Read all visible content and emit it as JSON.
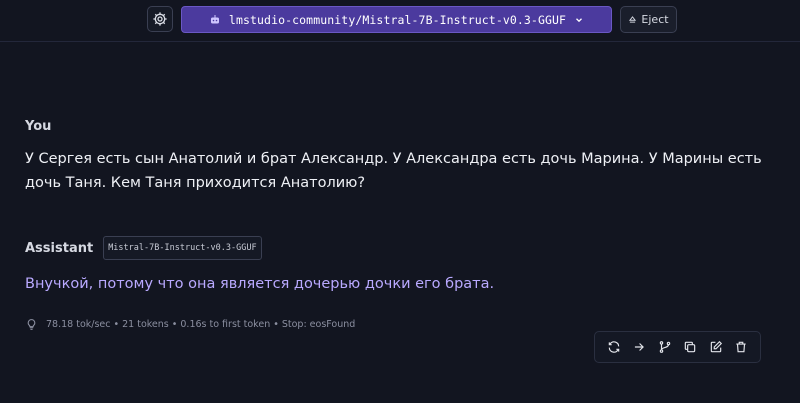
{
  "header": {
    "model_name": "lmstudio-community/Mistral-7B-Instruct-v0.3-GGUF",
    "eject_label": "Eject"
  },
  "chat": {
    "user": {
      "label": "You",
      "text": "У Сергея есть сын Анатолий и брат Александр. У Александра есть дочь Марина. У Марины есть дочь Таня. Кем Таня приходится Анатолию?"
    },
    "assistant": {
      "label": "Assistant",
      "model_tag": "Mistral-7B-Instruct-v0.3-GGUF",
      "text": "Внучкой, потому что она является дочерью дочки его брата.",
      "stats": "78.18 tok/sec • 21 tokens • 0.16s to first token • Stop: eosFound"
    }
  },
  "icons": {
    "settings": "gear-icon",
    "model": "robot-icon",
    "dropdown": "chevron-down-icon",
    "eject": "eject-icon",
    "stats": "lightbulb-icon",
    "actions": [
      "regenerate-icon",
      "continue-arrow-icon",
      "branch-icon",
      "copy-icon",
      "edit-icon",
      "trash-icon"
    ]
  },
  "colors": {
    "background": "#121520",
    "accent": "#4b3a9e",
    "assistant_text": "#b9a9ff"
  }
}
